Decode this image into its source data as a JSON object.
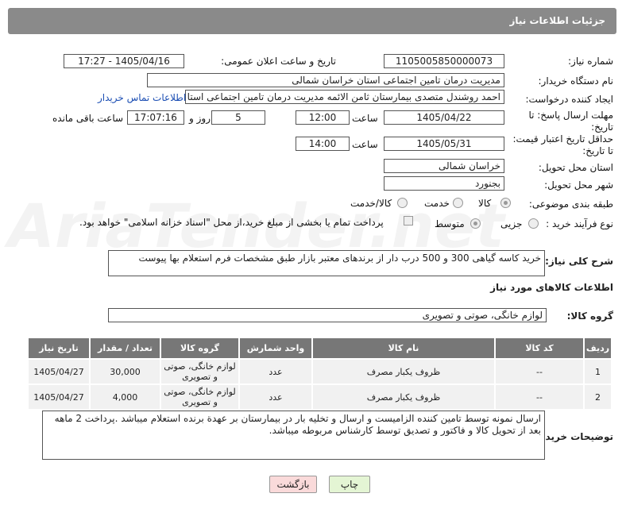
{
  "header": {
    "title": "جزئیات اطلاعات نیاز"
  },
  "fields": {
    "need_number_label": "شماره نیاز:",
    "need_number": "1105005850000073",
    "announce_label": "تاریخ و ساعت اعلان عمومی:",
    "announce_value": "1405/04/16 - 17:27",
    "buyer_org_label": "نام دستگاه خریدار:",
    "buyer_org": "مدیریت درمان تامین اجتماعی استان خراسان شمالی",
    "creator_label": "ایجاد کننده درخواست:",
    "creator": "احمد روشندل متصدی بیمارستان ثامن الائمه مدیریت درمان تامین اجتماعی استا",
    "contact_link": "اطلاعات تماس خریدار",
    "deadline_label": "مهلت ارسال پاسخ: تا تاریخ:",
    "deadline_date": "1405/04/22",
    "time_word": "ساعت",
    "deadline_time": "12:00",
    "days": "5",
    "days_word": "روز و",
    "remaining": "17:07:16",
    "remaining_word": "ساعت باقی مانده",
    "validity_label": "حداقل تاریخ اعتبار قیمت: تا تاریخ:",
    "validity_date": "1405/05/31",
    "validity_time": "14:00",
    "province_label": "استان محل تحویل:",
    "province": "خراسان شمالی",
    "city_label": "شهر محل تحویل:",
    "city": "بجنورد",
    "category_label": "طبقه بندی موضوعی:",
    "cat_goods": "کالا",
    "cat_service": "خدمت",
    "cat_goods_service": "کالا/خدمت",
    "process_label": "نوع فرآیند خرید :",
    "proc_small": "جزیی",
    "proc_medium": "متوسط",
    "payment_note": "پرداخت تمام یا بخشی از مبلغ خرید،از محل \"اسناد خزانه اسلامی\" خواهد بود."
  },
  "description": {
    "label": "شرح کلی نیاز:",
    "text": "خرید کاسه گیاهی 300 و 500 درب دار از برندهای معتبر بازار طبق مشخصات فرم استعلام بها پیوست"
  },
  "goods_info": {
    "title": "اطلاعات کالاهای مورد نیاز",
    "group_label": "گروه کالا:",
    "group_value": "لوازم خانگی، صوتی و تصویری"
  },
  "table": {
    "headers": [
      "ردیف",
      "کد کالا",
      "نام کالا",
      "واحد شمارش",
      "گروه کالا",
      "تعداد / مقدار",
      "تاریخ نیاز"
    ],
    "rows": [
      [
        "1",
        "--",
        "ظروف یکبار مصرف",
        "عدد",
        "لوازم خانگی، صوتی و تصویری",
        "30,000",
        "1405/04/27"
      ],
      [
        "2",
        "--",
        "ظروف یکبار مصرف",
        "عدد",
        "لوازم خانگی، صوتی و تصویری",
        "4,000",
        "1405/04/27"
      ]
    ]
  },
  "buyer_notes": {
    "label": "توضیحات خریدار:",
    "text": "ارسال نمونه توسط تامین کننده الزامیست و ارسال و تخلیه بار در بیمارستان بر عهدة برنده استعلام میباشد .پرداخت 2 ماهه بعد از تحویل کالا و فاکتور و تصدیق توسط کارشناس مربوطه میباشد."
  },
  "buttons": {
    "print": "چاپ",
    "back": "بازگشت"
  },
  "colors": {
    "header_bg": "#8a8a8a",
    "table_header_bg": "#777777",
    "print_btn": "#e4f5d4",
    "back_btn": "#fadada",
    "link": "#1a4db3"
  }
}
